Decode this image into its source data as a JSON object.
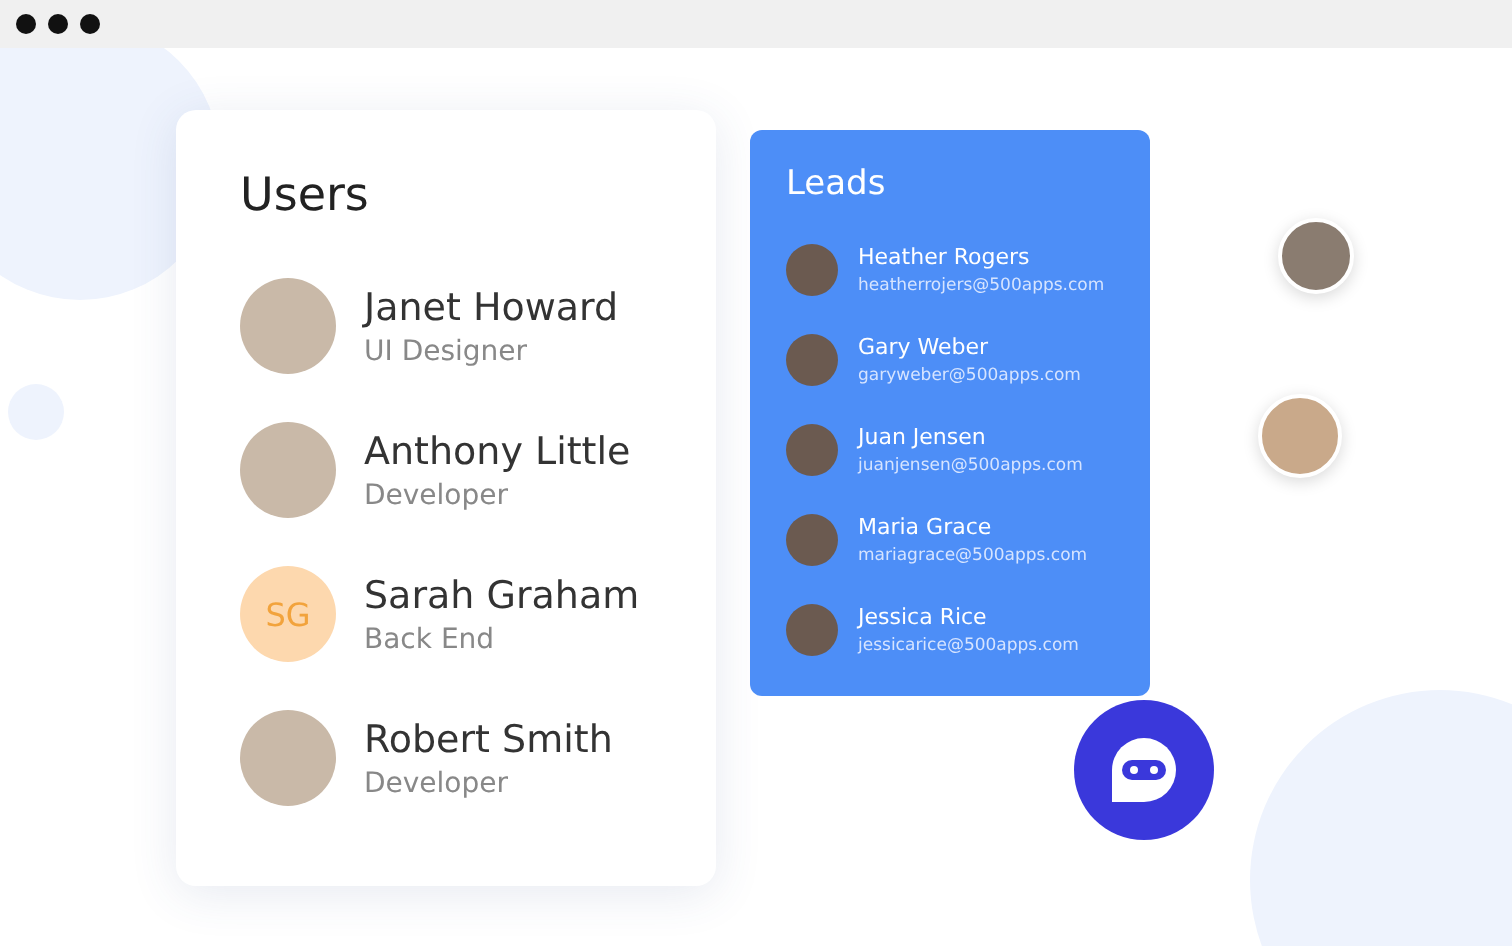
{
  "users_card": {
    "title": "Users",
    "users": [
      {
        "name": "Janet Howard",
        "role": "UI Designer",
        "kind": "photo"
      },
      {
        "name": "Anthony Little",
        "role": "Developer",
        "kind": "photo"
      },
      {
        "name": "Sarah Graham",
        "role": "Back End",
        "kind": "initials",
        "initials": "SG"
      },
      {
        "name": "Robert Smith",
        "role": "Developer",
        "kind": "photo"
      }
    ]
  },
  "leads_card": {
    "title": "Leads",
    "leads": [
      {
        "name": "Heather Rogers",
        "email": "heatherrojers@500apps.com"
      },
      {
        "name": "Gary Weber",
        "email": "garyweber@500apps.com"
      },
      {
        "name": "Juan Jensen",
        "email": "juanjensen@500apps.com"
      },
      {
        "name": "Maria Grace",
        "email": "mariagrace@500apps.com"
      },
      {
        "name": "Jessica Rice",
        "email": "jessicarice@500apps.com"
      }
    ]
  }
}
